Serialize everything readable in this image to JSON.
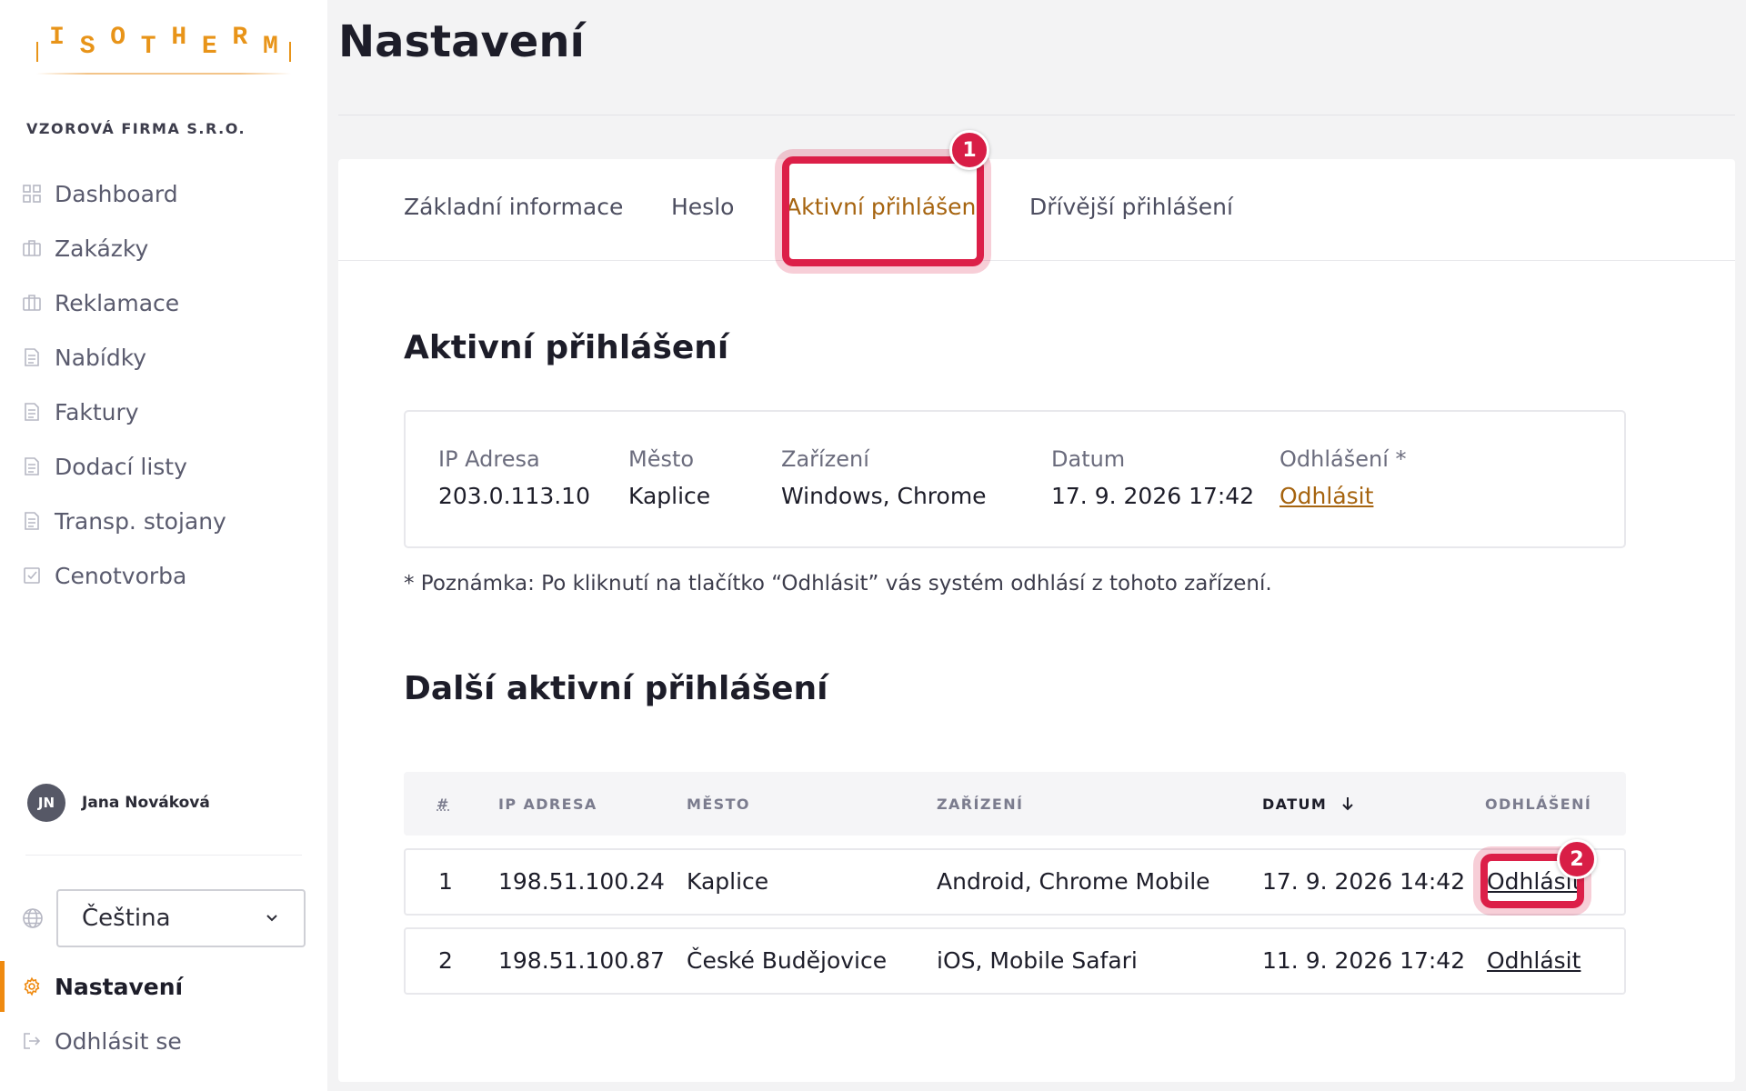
{
  "brand": {
    "logo_letters": [
      "I",
      "S",
      "O",
      "T",
      "H",
      "E",
      "R",
      "M"
    ],
    "accent": "#ef8a10"
  },
  "company": "VZOROVÁ FIRMA S.R.O.",
  "nav": [
    {
      "label": "Dashboard",
      "icon": "grid-icon"
    },
    {
      "label": "Zakázky",
      "icon": "briefcase-icon"
    },
    {
      "label": "Reklamace",
      "icon": "briefcase-icon"
    },
    {
      "label": "Nabídky",
      "icon": "document-icon"
    },
    {
      "label": "Faktury",
      "icon": "document-icon"
    },
    {
      "label": "Dodací listy",
      "icon": "document-icon"
    },
    {
      "label": "Transp. stojany",
      "icon": "document-icon"
    },
    {
      "label": "Cenotvorba",
      "icon": "checkbox-icon"
    }
  ],
  "user": {
    "initials": "JN",
    "name": "Jana Nováková"
  },
  "language": {
    "selected": "Čeština"
  },
  "nav_bottom": {
    "settings": "Nastavení",
    "logout": "Odhlásit se"
  },
  "page": {
    "title": "Nastavení"
  },
  "tabs": [
    {
      "label": "Základní informace"
    },
    {
      "label": "Heslo"
    },
    {
      "label": "Aktivní přihlášení"
    },
    {
      "label": "Dřívější přihlášení"
    }
  ],
  "annotations": {
    "badge1": "1",
    "badge2": "2",
    "color": "#dc1f48"
  },
  "current": {
    "title": "Aktivní přihlášení",
    "labels": {
      "ip": "IP Adresa",
      "city": "Město",
      "device": "Zařízení",
      "date": "Datum",
      "logout": "Odhlášení *"
    },
    "values": {
      "ip": "203.0.113.10",
      "city": "Kaplice",
      "device": "Windows, Chrome",
      "date": "17. 9. 2026 17:42",
      "logout": "Odhlásit"
    },
    "note": "* Poznámka: Po kliknutí na tlačítko “Odhlásit” vás systém odhlásí z tohoto zařízení."
  },
  "others": {
    "title": "Další aktivní přihlášení",
    "headers": {
      "num": "#",
      "ip": "IP ADRESA",
      "city": "MĚSTO",
      "device": "ZAŘÍZENÍ",
      "date": "DATUM",
      "logout": "ODHLÁŠENÍ"
    },
    "rows": [
      {
        "num": "1",
        "ip": "198.51.100.24",
        "city": "Kaplice",
        "device": "Android, Chrome Mobile",
        "date": "17. 9. 2026 14:42",
        "logout": "Odhlásit"
      },
      {
        "num": "2",
        "ip": "198.51.100.87",
        "city": "České Budějovice",
        "device": "iOS, Mobile Safari",
        "date": "11. 9. 2026 17:42",
        "logout": "Odhlásit"
      }
    ]
  }
}
